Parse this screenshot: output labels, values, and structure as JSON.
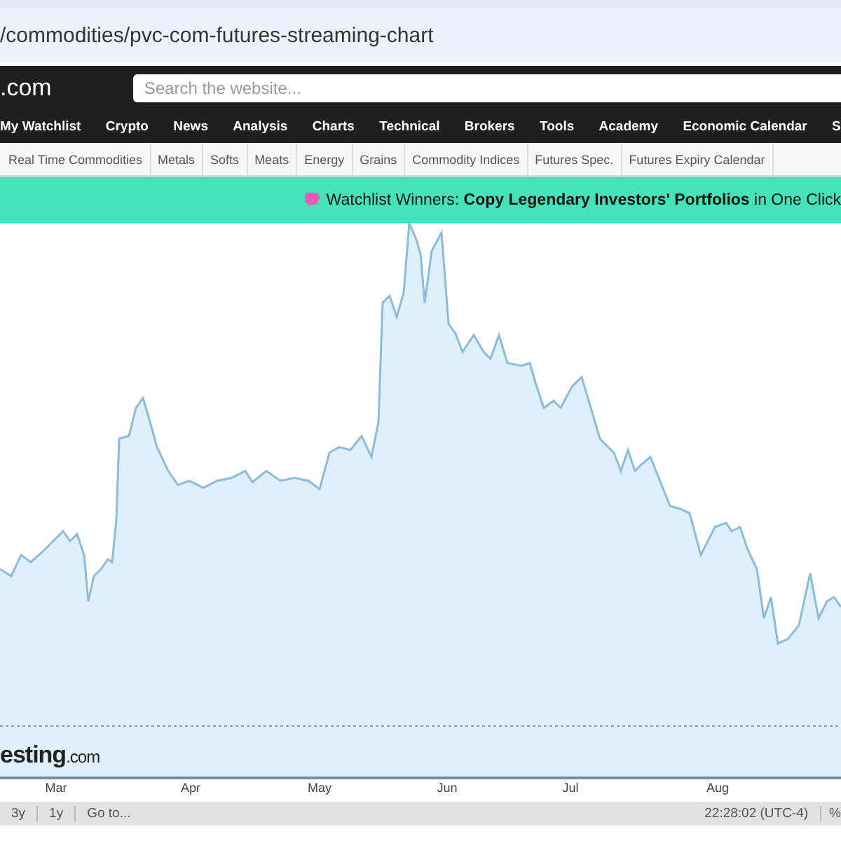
{
  "address_bar": {
    "url": "/commodities/pvc-com-futures-streaming-chart"
  },
  "header": {
    "logo": ".com",
    "search": {
      "placeholder": "Search the website..."
    }
  },
  "nav": {
    "items": [
      "My Watchlist",
      "Crypto",
      "News",
      "Analysis",
      "Charts",
      "Technical",
      "Brokers",
      "Tools",
      "Academy",
      "Economic Calendar",
      "S"
    ]
  },
  "subnav": {
    "items": [
      "Real Time Commodities",
      "Metals",
      "Softs",
      "Meats",
      "Energy",
      "Grains",
      "Commodity Indices",
      "Futures Spec.",
      "Futures Expiry Calendar"
    ]
  },
  "banner": {
    "text": "Watchlist Winners: **Copy Legendary Investors' Portfolios** in One Click"
  },
  "chart": {
    "logo": "esting",
    "logo_suffix": ".com",
    "x_axis_labels": [
      "Mar",
      "Apr",
      "May",
      "Jun",
      "Jul",
      "Aug"
    ]
  },
  "bottom_bar": {
    "ranges": [
      "3y",
      "1y"
    ],
    "goto": "Go to...",
    "time": "22:28:02 (UTC-4)",
    "percent": "%"
  }
}
